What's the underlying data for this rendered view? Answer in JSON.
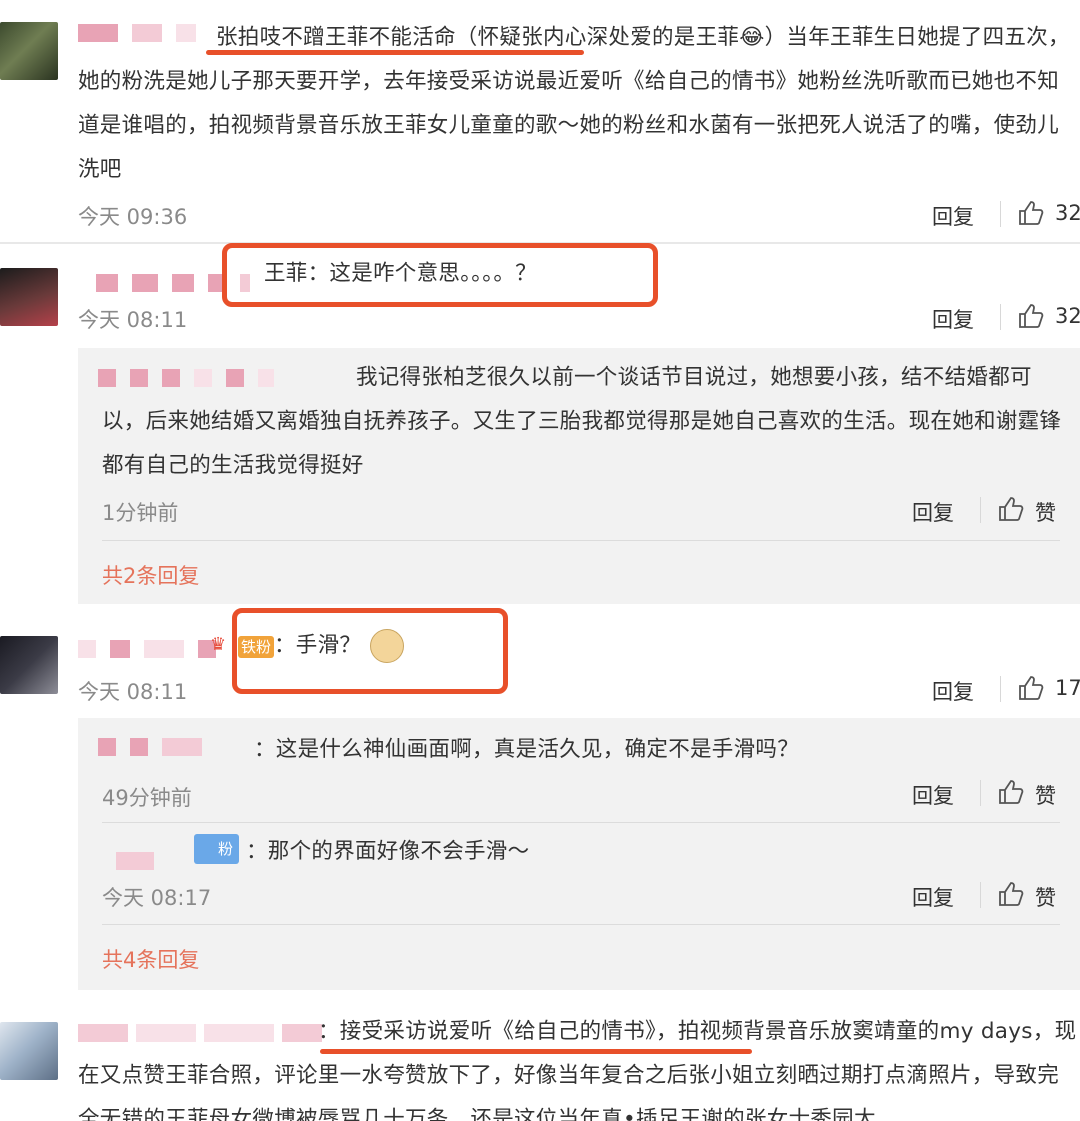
{
  "comments": [
    {
      "text": "张拍吱不蹭王菲不能活命（怀疑张内心深处爱的是王菲😂）当年王菲生日她提了四五次，她的粉洗是她儿子那天要开学，去年接受采访说最近爱听《给自己的情书》她粉丝洗听歌而已她也不知道是谁唱的，拍视频背景音乐放王菲女儿童童的歌～她的粉丝和水菌有一张把死人说活了的嘴，使劲儿洗吧",
      "time": "今天 09:36",
      "reply_label": "回复",
      "likes": "32"
    },
    {
      "name_suffix": "：",
      "text": "王菲：这是咋个意思。。。。？",
      "time": "今天 08:11",
      "reply_label": "回复",
      "likes": "32",
      "replies": [
        {
          "text": "我记得张柏芝很久以前一个谈话节目说过，她想要小孩，结不结婚都可以，后来她结婚又离婚独自抚养孩子。又生了三胎我都觉得那是她自己喜欢的生活。现在她和谢霆锋都有自己的生活我觉得挺好",
          "time": "1分钟前",
          "reply_label": "回复",
          "like_label": "赞"
        }
      ],
      "total_replies": "共2条回复"
    },
    {
      "badge": "铁粉",
      "text": "：手滑？",
      "time": "今天 08:11",
      "reply_label": "回复",
      "likes": "17",
      "replies": [
        {
          "text": "：这是什么神仙画面啊，真是活久见，确定不是手滑吗？",
          "time": "49分钟前",
          "reply_label": "回复",
          "like_label": "赞"
        },
        {
          "badge": "粉",
          "text": "：那个的界面好像不会手滑～",
          "time": "今天 08:17",
          "reply_label": "回复",
          "like_label": "赞"
        }
      ],
      "total_replies": "共4条回复"
    },
    {
      "text": "：接受采访说爱听《给自己的情书》，拍视频背景音乐放窦靖童的my days，现在又点赞王菲合照，评论里一水夸赞放下了，好像当年复合之后张小姐立刻晒过期打点滴照片，导致完全无错的王菲母女微博被辱骂几十万条，还是这位当年真•插足王谢的张女士秀园太"
    }
  ],
  "colors": {
    "accent_orange": "#e5735b",
    "annotation_red": "#e8502a",
    "reply_bg": "#f2f2f2"
  }
}
